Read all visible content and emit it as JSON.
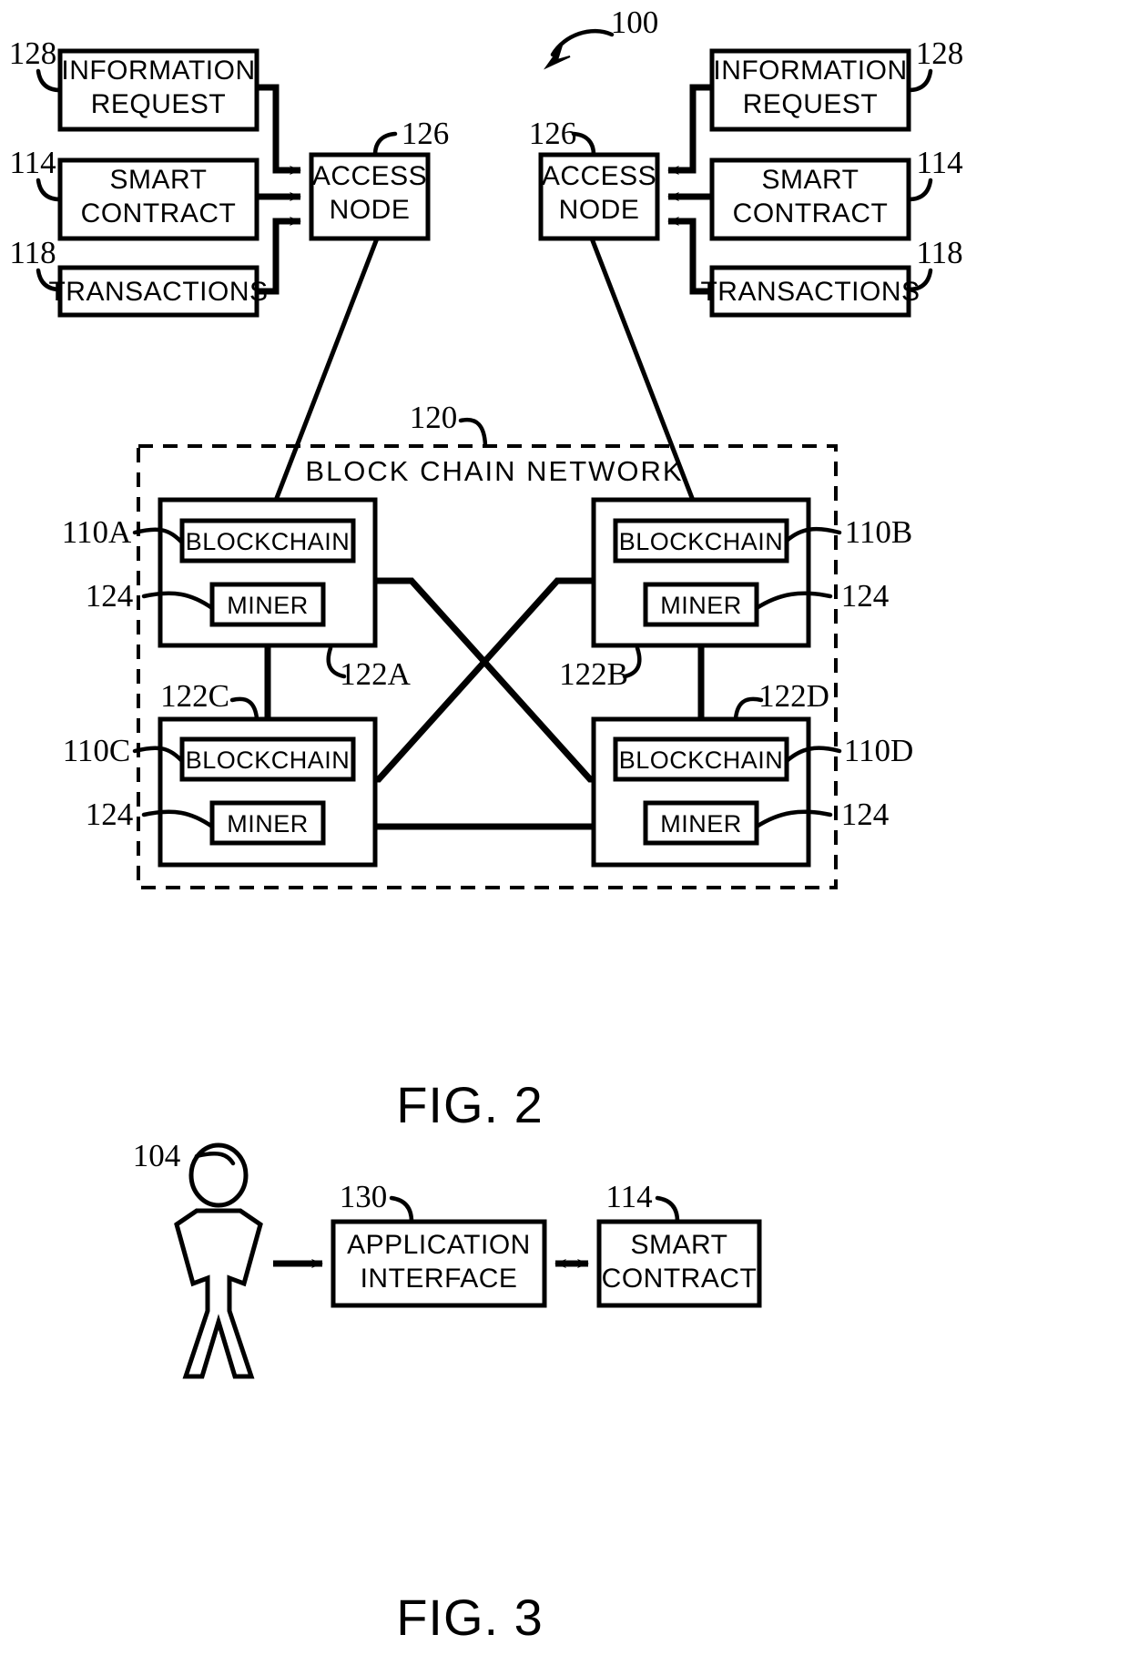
{
  "figure_2": {
    "caption": "FIG. 2",
    "system_ref": "100",
    "left_group": {
      "information_request": {
        "label_line1": "INFORMATION",
        "label_line2": "REQUEST",
        "ref": "128"
      },
      "smart_contract": {
        "label_line1": "SMART",
        "label_line2": "CONTRACT",
        "ref": "114"
      },
      "transactions": {
        "label": "TRANSACTIONS",
        "ref": "118"
      },
      "access_node": {
        "label_line1": "ACCESS",
        "label_line2": "NODE",
        "ref": "126"
      }
    },
    "right_group": {
      "information_request": {
        "label_line1": "INFORMATION",
        "label_line2": "REQUEST",
        "ref": "128"
      },
      "smart_contract": {
        "label_line1": "SMART",
        "label_line2": "CONTRACT",
        "ref": "114"
      },
      "transactions": {
        "label": "TRANSACTIONS",
        "ref": "118"
      },
      "access_node": {
        "label_line1": "ACCESS",
        "label_line2": "NODE",
        "ref": "126"
      }
    },
    "network": {
      "title": "BLOCK  CHAIN  NETWORK",
      "ref": "120",
      "nodes": [
        {
          "node_ref": "122A",
          "blockchain_label": "BLOCKCHAIN",
          "blockchain_ref": "110A",
          "miner_label": "MINER",
          "miner_ref": "124"
        },
        {
          "node_ref": "122B",
          "blockchain_label": "BLOCKCHAIN",
          "blockchain_ref": "110B",
          "miner_label": "MINER",
          "miner_ref": "124"
        },
        {
          "node_ref": "122C",
          "blockchain_label": "BLOCKCHAIN",
          "blockchain_ref": "110C",
          "miner_label": "MINER",
          "miner_ref": "124"
        },
        {
          "node_ref": "122D",
          "blockchain_label": "BLOCKCHAIN",
          "blockchain_ref": "110D",
          "miner_label": "MINER",
          "miner_ref": "124"
        }
      ]
    }
  },
  "figure_3": {
    "caption": "FIG. 3",
    "user": {
      "ref": "104"
    },
    "application_interface": {
      "label_line1": "APPLICATION",
      "label_line2": "INTERFACE",
      "ref": "130"
    },
    "smart_contract": {
      "label_line1": "SMART",
      "label_line2": "CONTRACT",
      "ref": "114"
    }
  },
  "colors": {
    "ink": "#000000",
    "paper": "#ffffff"
  }
}
